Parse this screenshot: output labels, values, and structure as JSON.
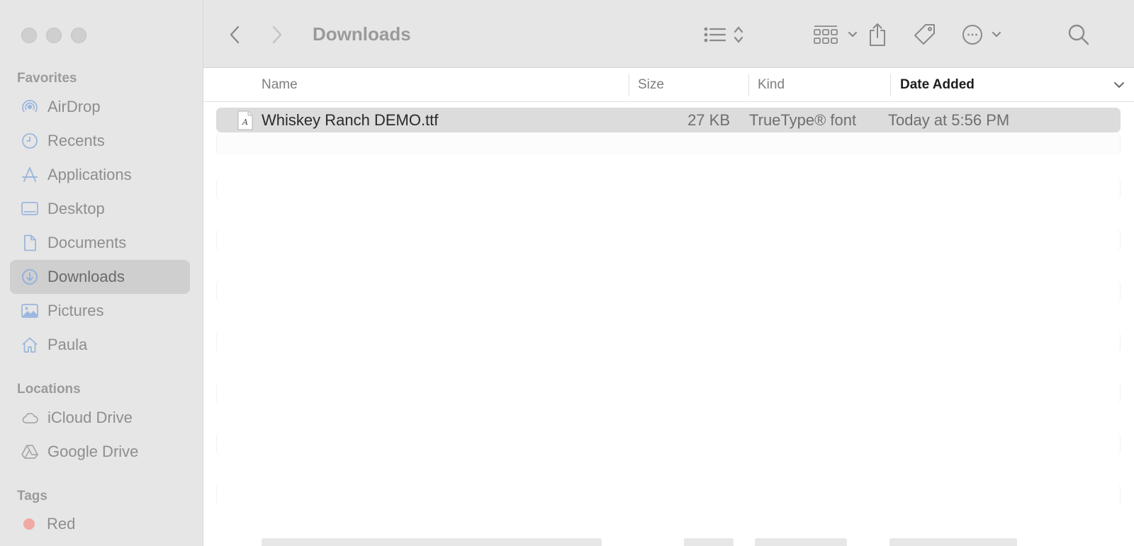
{
  "window": {
    "title": "Downloads"
  },
  "sidebar": {
    "favorites_label": "Favorites",
    "favorites": [
      {
        "label": "AirDrop",
        "icon": "airdrop-icon"
      },
      {
        "label": "Recents",
        "icon": "clock-icon"
      },
      {
        "label": "Applications",
        "icon": "applications-icon"
      },
      {
        "label": "Desktop",
        "icon": "desktop-icon"
      },
      {
        "label": "Documents",
        "icon": "document-icon"
      },
      {
        "label": "Downloads",
        "icon": "download-icon",
        "selected": true
      },
      {
        "label": "Pictures",
        "icon": "photo-icon"
      },
      {
        "label": "Paula",
        "icon": "home-icon"
      }
    ],
    "locations_label": "Locations",
    "locations": [
      {
        "label": "iCloud Drive",
        "icon": "cloud-icon"
      },
      {
        "label": "Google Drive",
        "icon": "drive-icon"
      }
    ],
    "tags_label": "Tags",
    "tags": [
      {
        "label": "Red",
        "color": "#f1a9a4"
      }
    ]
  },
  "toolbar": {
    "icons": [
      "back-icon",
      "forward-icon",
      "list-view-icon",
      "group-icon",
      "share-icon",
      "tag-icon",
      "more-icon",
      "search-icon"
    ]
  },
  "columns": {
    "name": "Name",
    "size": "Size",
    "kind": "Kind",
    "date_added": "Date Added",
    "sorted_by": "Date Added"
  },
  "files": [
    {
      "name": "Whiskey Ranch DEMO.ttf",
      "size": "27 KB",
      "kind": "TrueType® font",
      "date_added": "Today at 5:56 PM",
      "icon": "font-file-icon",
      "selected": true
    }
  ],
  "colors": {
    "accent_icon": "#9bb7dd",
    "sidebar_bg": "#e6e6e6",
    "selection_bg": "#dcdcdc"
  }
}
